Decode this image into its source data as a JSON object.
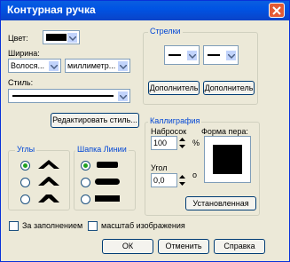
{
  "window": {
    "title": "Контурная ручка"
  },
  "labels": {
    "color": "Цвет:",
    "width": "Ширина:",
    "style": "Стиль:"
  },
  "width_combo": {
    "value": "Волося..."
  },
  "units_combo": {
    "value": "миллиметр..."
  },
  "edit_style_button": "Редактировать стиль...",
  "arrows": {
    "title": "Стрелки",
    "option1_button": "Дополнитель",
    "option2_button": "Дополнитель"
  },
  "corners": {
    "title": "Углы"
  },
  "line_caps": {
    "title": "Шапка Линии"
  },
  "calligraphy": {
    "title": "Каллиграфия",
    "stretch_label": "Набросок",
    "stretch_value": "100",
    "stretch_unit": "%",
    "angle_label": "Угол",
    "angle_value": "0,0",
    "angle_unit": "o",
    "nib_label": "Форма пера:",
    "default_button": "Установленная"
  },
  "checkboxes": {
    "behind_fill": "За заполнением",
    "scale_with_image": "масштаб изображения"
  },
  "footer": {
    "ok": "ОК",
    "cancel": "Отменить",
    "help": "Справка"
  },
  "colors": {
    "titlebar": "#0054e3",
    "pen_color": "#000000",
    "group_title": "#0046d5"
  }
}
